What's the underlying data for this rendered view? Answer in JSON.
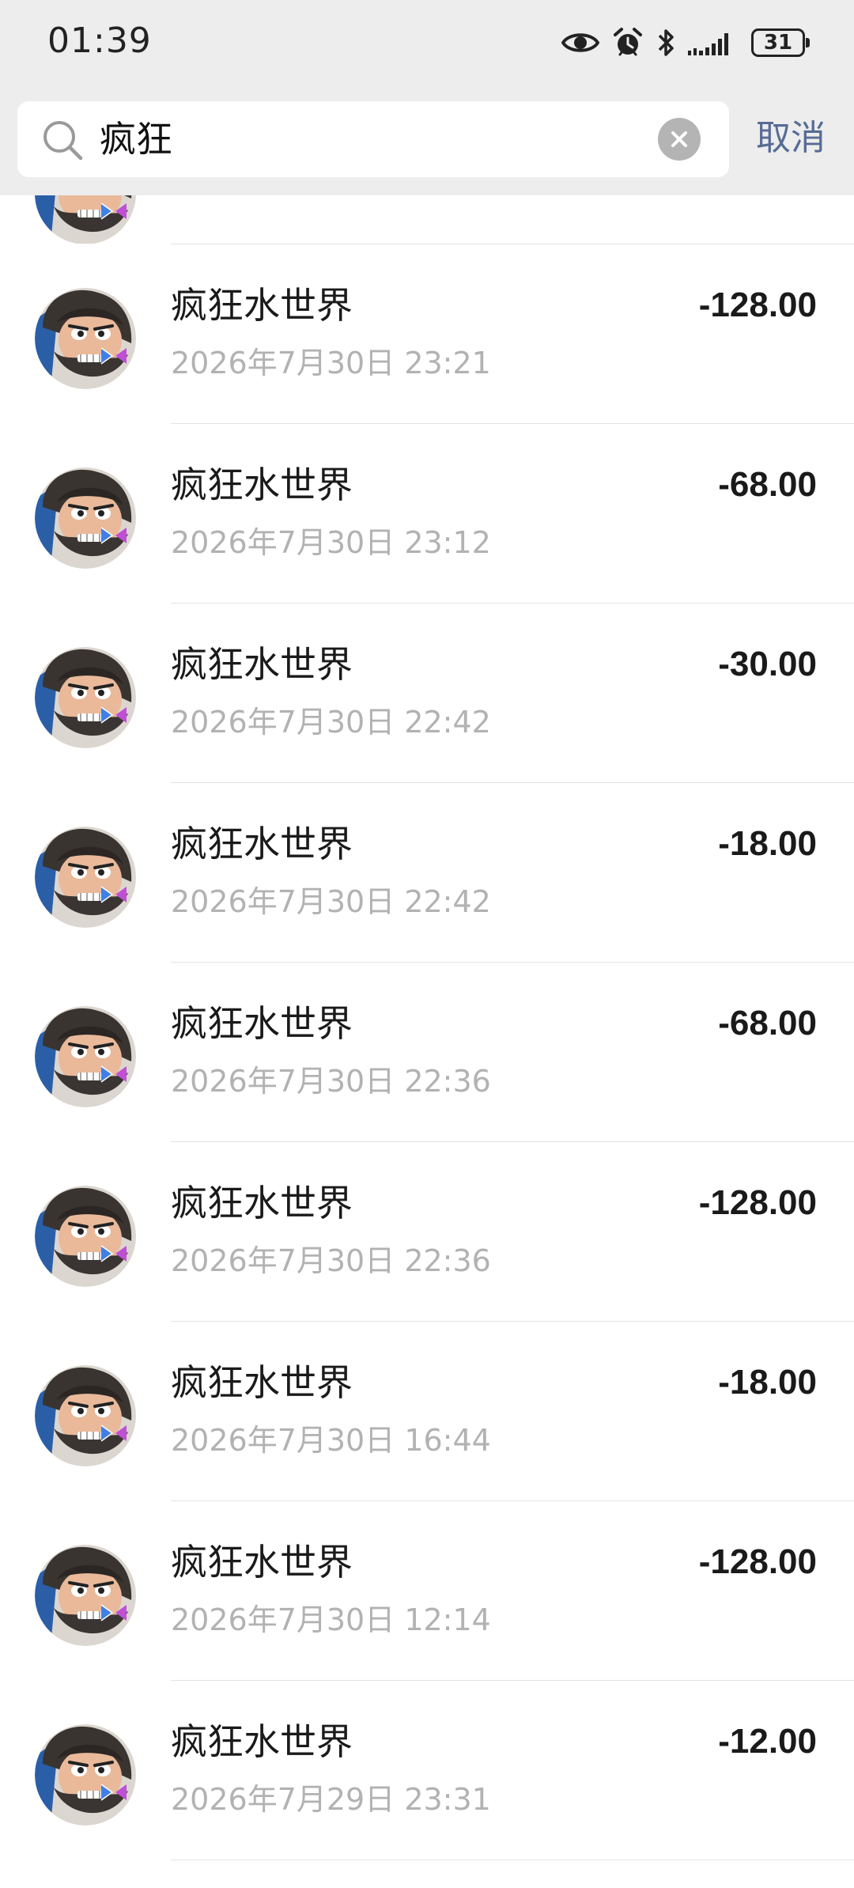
{
  "status_bar": {
    "time": "01:39",
    "icons": [
      "eye-icon",
      "alarm-icon",
      "bluetooth-icon",
      "signal-icon"
    ],
    "battery": "31"
  },
  "search": {
    "query": "疯狂",
    "cancel_label": "取消"
  },
  "colors": {
    "header_bg": "#ededed",
    "link": "#576b95",
    "secondary_text": "#b2b2b2"
  },
  "transactions": [
    {
      "name": "疯狂水世界",
      "time": "2026年7月30日 23:21",
      "amount": "-128.00"
    },
    {
      "name": "疯狂水世界",
      "time": "2026年7月30日 23:12",
      "amount": "-68.00"
    },
    {
      "name": "疯狂水世界",
      "time": "2026年7月30日 22:42",
      "amount": "-30.00"
    },
    {
      "name": "疯狂水世界",
      "time": "2026年7月30日 22:42",
      "amount": "-18.00"
    },
    {
      "name": "疯狂水世界",
      "time": "2026年7月30日 22:36",
      "amount": "-68.00"
    },
    {
      "name": "疯狂水世界",
      "time": "2026年7月30日 22:36",
      "amount": "-128.00"
    },
    {
      "name": "疯狂水世界",
      "time": "2026年7月30日 16:44",
      "amount": "-18.00"
    },
    {
      "name": "疯狂水世界",
      "time": "2026年7月30日 12:14",
      "amount": "-128.00"
    },
    {
      "name": "疯狂水世界",
      "time": "2026年7月29日 23:31",
      "amount": "-12.00"
    }
  ]
}
